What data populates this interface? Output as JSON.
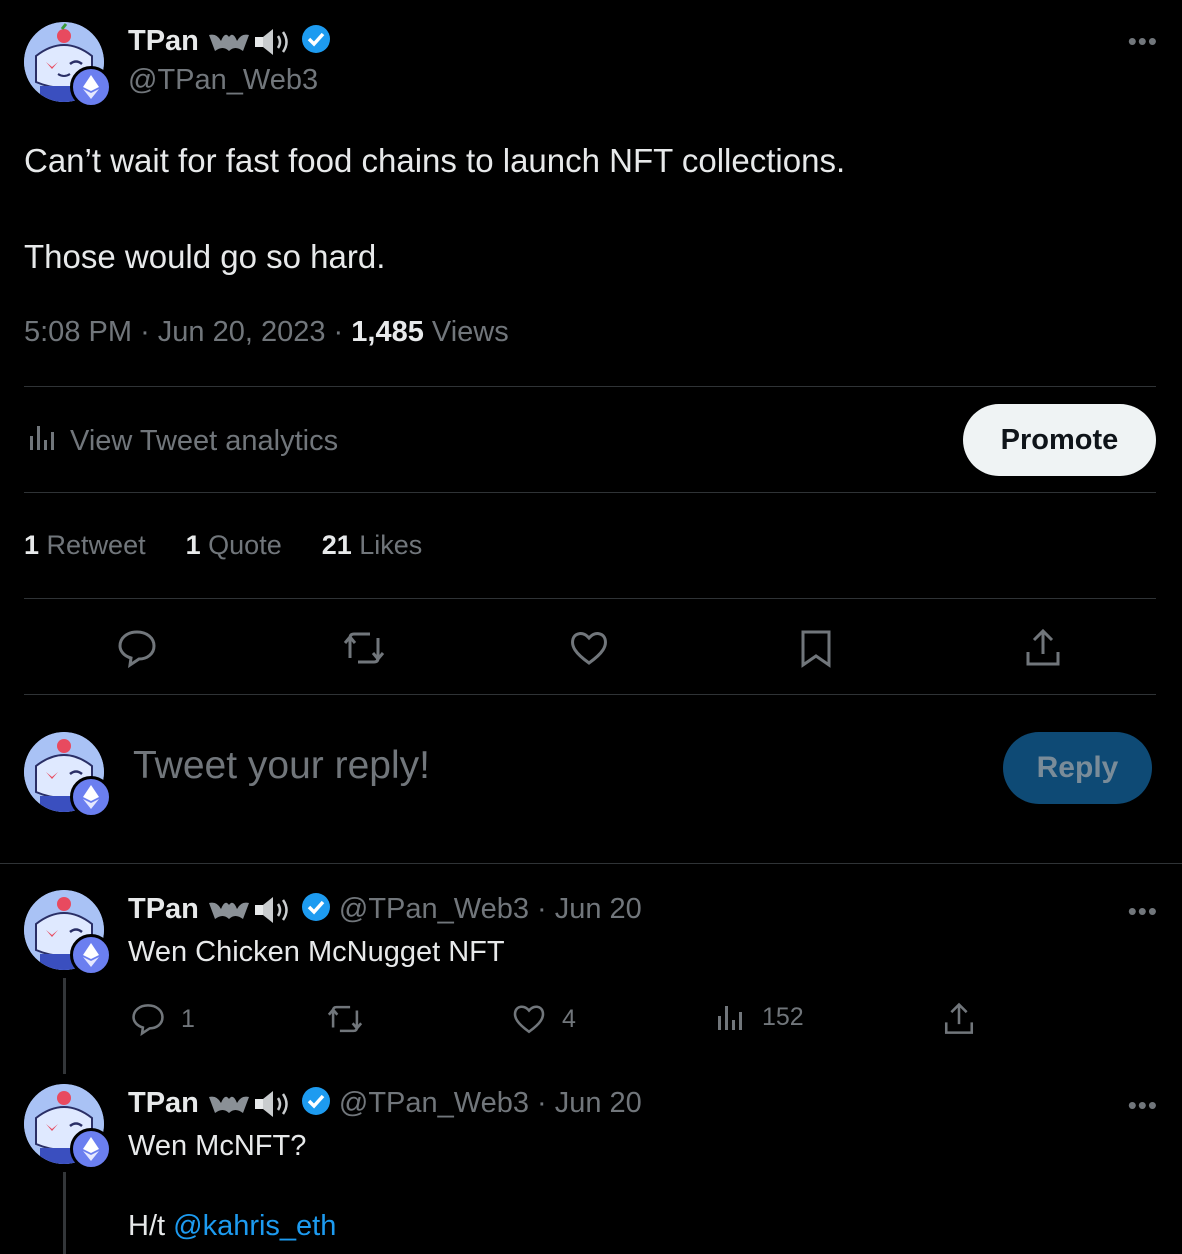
{
  "main_tweet": {
    "author_name": "TPan",
    "author_handle": "@TPan_Web3",
    "text_line1": "Can’t wait for fast food chains to launch NFT collections.",
    "text_line2": "Those would go so hard.",
    "time": "5:08 PM",
    "date": "Jun 20, 2023",
    "views_count": "1,485",
    "views_label": "Views",
    "analytics_label": "View Tweet analytics",
    "promote_label": "Promote",
    "retweets_count": "1",
    "retweets_label": "Retweet",
    "quotes_count": "1",
    "quotes_label": "Quote",
    "likes_count": "21",
    "likes_label": "Likes"
  },
  "reply_box": {
    "placeholder": "Tweet your reply!",
    "button_label": "Reply"
  },
  "replies": [
    {
      "author_name": "TPan",
      "author_handle": "@TPan_Web3",
      "date": "Jun 20",
      "text": "Wen Chicken McNugget NFT",
      "reply_count": "1",
      "like_count": "4",
      "view_count": "152"
    },
    {
      "author_name": "TPan",
      "author_handle": "@TPan_Web3",
      "date": "Jun 20",
      "text_line1": "Wen McNFT?",
      "text_line2_prefix": "H/t ",
      "mention": "@kahris_eth"
    }
  ],
  "colors": {
    "accent": "#1d9bf0",
    "background": "#000000",
    "muted": "#71767b"
  }
}
